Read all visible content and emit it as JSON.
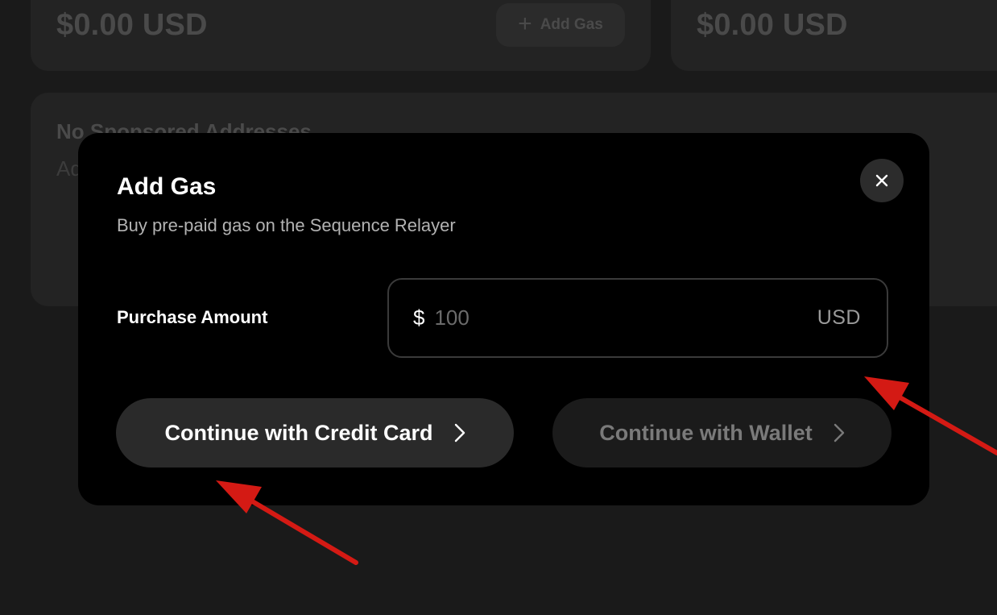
{
  "background": {
    "left_card": {
      "amount": "$0.00 USD",
      "add_gas_label": "Add Gas"
    },
    "right_card": {
      "amount": "$0.00 USD"
    },
    "sponsored": {
      "title": "No Sponsored Addresses",
      "subtitle": "Ad"
    }
  },
  "modal": {
    "title": "Add Gas",
    "subtitle": "Buy pre-paid gas on the Sequence Relayer",
    "purchase": {
      "label": "Purchase Amount",
      "currency_symbol": "$",
      "placeholder": "100",
      "value": "",
      "unit": "USD"
    },
    "buttons": {
      "credit_card": "Continue with Credit Card",
      "wallet": "Continue with Wallet"
    }
  },
  "colors": {
    "page_bg": "#1a1a1a",
    "card_bg": "#232323",
    "modal_bg": "#000000",
    "primary_button_bg": "#2a2a2a",
    "disabled_button_bg": "#1b1b1b",
    "annotation_arrow": "#d41a14"
  },
  "icons": {
    "close": "close-icon",
    "plus": "plus-icon",
    "chevron": "chevron-right-icon",
    "annotation": "red-arrow-icon"
  }
}
